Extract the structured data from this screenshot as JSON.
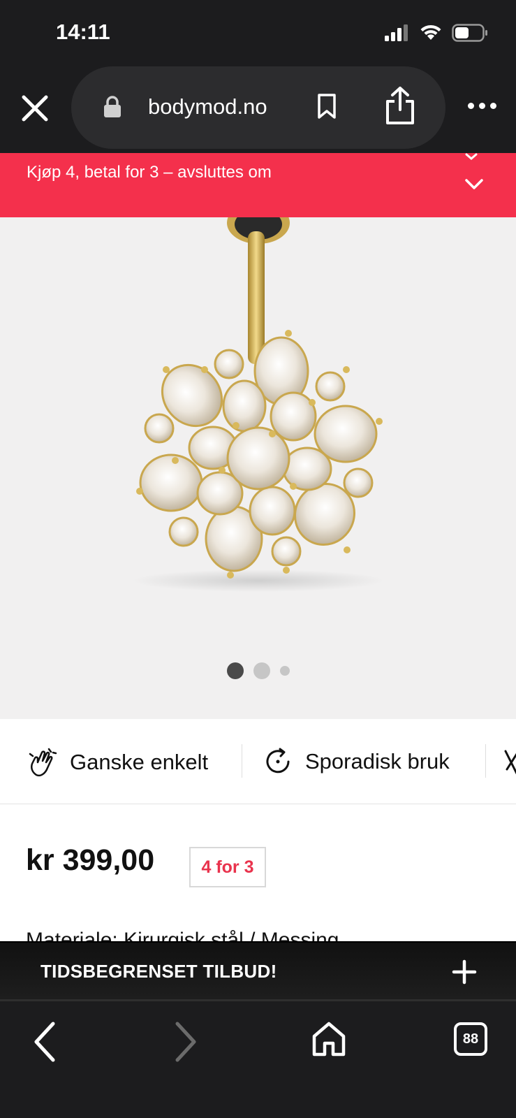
{
  "status_bar": {
    "time": "14:11"
  },
  "browser": {
    "url": "bodymod.no"
  },
  "promo": {
    "text": "Kjøp 4, betal for 3 – avsluttes om"
  },
  "gallery": {
    "total_images": 3,
    "current_index": 1
  },
  "features": [
    {
      "label": "Ganske enkelt",
      "icon": "hand-wave-icon"
    },
    {
      "label": "Sporadisk bruk",
      "icon": "refresh-circle-icon"
    }
  ],
  "product": {
    "price": "kr 399,00",
    "offer_badge": "4 for 3",
    "cut_off_text": "Materiale: Kirurgisk stål / Messing"
  },
  "offer_bar": {
    "text": "TIDSBEGRENSET TILBUD!"
  },
  "bottom_nav": {
    "tab_count": "88"
  },
  "colors": {
    "promo": "#f4304c",
    "badge_text": "#e9334d",
    "dark": "#1c1c1e"
  }
}
